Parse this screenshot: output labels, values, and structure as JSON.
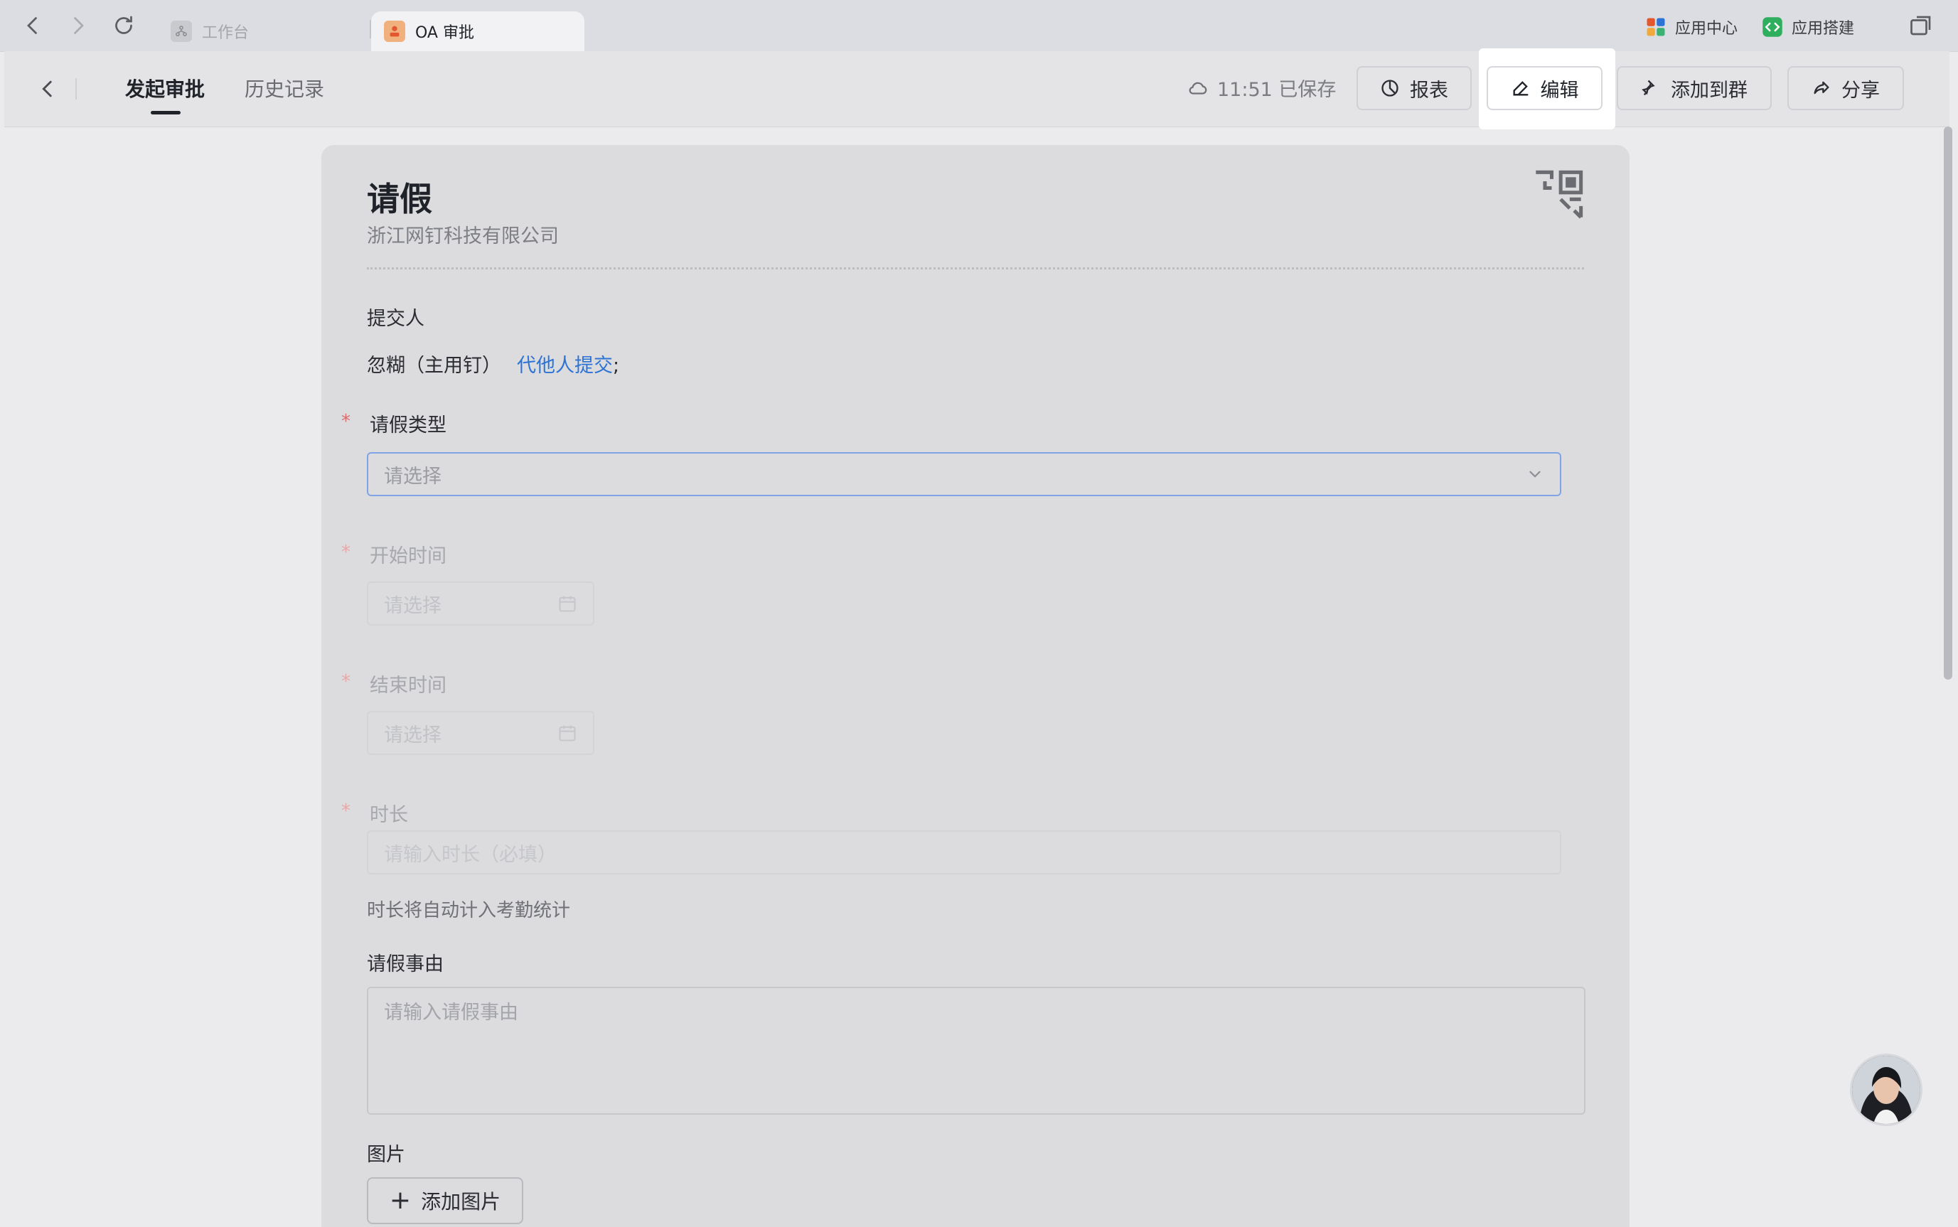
{
  "tabstrip": {
    "tabs": [
      {
        "label": "工作台",
        "active": false
      },
      {
        "label": "OA 审批",
        "active": true
      }
    ],
    "app_center_label": "应用中心",
    "app_builder_label": "应用搭建"
  },
  "header": {
    "tabs": [
      {
        "label": "发起审批",
        "active": true
      },
      {
        "label": "历史记录",
        "active": false
      }
    ],
    "saved_status": "11:51 已保存",
    "buttons": {
      "report": "报表",
      "edit": "编辑",
      "add_to_group": "添加到群",
      "share": "分享"
    }
  },
  "form": {
    "title": "请假",
    "company": "浙江网钉科技有限公司",
    "submitter_label": "提交人",
    "submitter_name": "忽糊（主用钉）",
    "submit_for_others": "代他人提交",
    "submit_suffix": ";",
    "leave_type": {
      "label": "请假类型",
      "placeholder": "请选择"
    },
    "start_time": {
      "label": "开始时间",
      "placeholder": "请选择"
    },
    "end_time": {
      "label": "结束时间",
      "placeholder": "请选择"
    },
    "duration": {
      "label": "时长",
      "placeholder": "请输入时长（必填）",
      "hint": "时长将自动计入考勤统计"
    },
    "reason": {
      "label": "请假事由",
      "placeholder": "请输入请假事由"
    },
    "images": {
      "label": "图片",
      "button": "添加图片"
    },
    "required_mark": "*"
  },
  "colors": {
    "link": "#2d73d6",
    "required": "#e06a6a",
    "focus_border": "#7fa3e6"
  }
}
